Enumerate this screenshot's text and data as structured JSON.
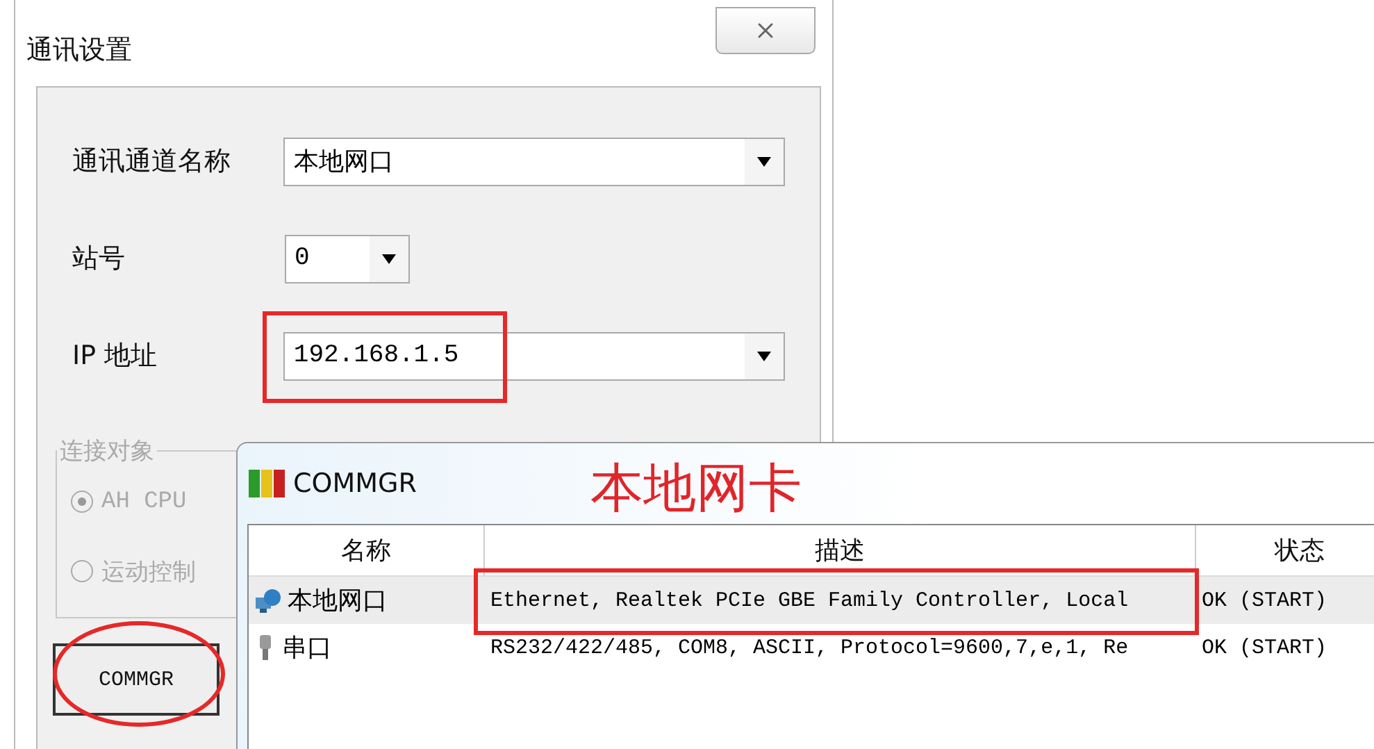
{
  "settings_dialog": {
    "title": "通讯设置",
    "fields": [
      {
        "label": "通讯通道名称",
        "value": "本地网口",
        "kind": "wide"
      },
      {
        "label": "站号",
        "value": "0",
        "kind": "narrow"
      },
      {
        "label": "IP 地址",
        "value": "192.168.1.5",
        "kind": "wide"
      }
    ],
    "connection_group": {
      "title": "连接对象",
      "options": [
        {
          "label": "AH CPU",
          "selected": true
        },
        {
          "label": "运动控制",
          "selected": false
        }
      ]
    },
    "commgr_button": "COMMGR"
  },
  "commgr_window": {
    "title": "COMMGR",
    "columns": [
      "名称",
      "描述",
      "状态"
    ],
    "rows": [
      {
        "kind": "network",
        "name": "本地网口",
        "description": "Ethernet, Realtek PCIe GBE Family Controller, Local",
        "status": "OK (START)",
        "selected": true
      },
      {
        "kind": "serial",
        "name": "串口",
        "description": "RS232/422/485, COM8, ASCII, Protocol=9600,7,e,1, Re",
        "status": "OK (START)",
        "selected": false
      }
    ]
  },
  "annotation": {
    "label": "本地网卡"
  }
}
